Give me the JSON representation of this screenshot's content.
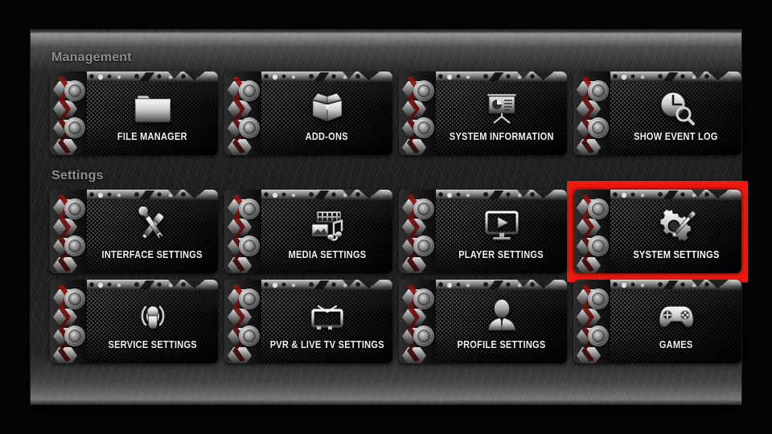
{
  "window": {
    "accent_selected": "#f01a10",
    "background": "#050505",
    "panel_background": "#222222"
  },
  "sections": [
    {
      "id": "management",
      "label": "Management",
      "rows": [
        [
          {
            "label": "FILE MANAGER",
            "icon": "folder-icon",
            "selected": false
          },
          {
            "label": "ADD-ONS",
            "icon": "open-box-icon",
            "selected": false
          },
          {
            "label": "SYSTEM INFORMATION",
            "icon": "presentation-chart-icon",
            "selected": false
          },
          {
            "label": "SHOW EVENT LOG",
            "icon": "clock-search-icon",
            "selected": false
          }
        ]
      ]
    },
    {
      "id": "settings",
      "label": "Settings",
      "rows": [
        [
          {
            "label": "INTERFACE SETTINGS",
            "icon": "screwdriver-wrench-icon",
            "selected": false
          },
          {
            "label": "MEDIA SETTINGS",
            "icon": "film-photo-music-icon",
            "selected": false
          },
          {
            "label": "PLAYER SETTINGS",
            "icon": "monitor-play-icon",
            "selected": false
          },
          {
            "label": "SYSTEM SETTINGS",
            "icon": "gear-screwdriver-icon",
            "selected": true
          }
        ],
        [
          {
            "label": "SERVICE SETTINGS",
            "icon": "broadcast-signal-icon",
            "selected": false
          },
          {
            "label": "PVR & LIVE TV SETTINGS",
            "icon": "retro-tv-icon",
            "selected": false
          },
          {
            "label": "PROFILE SETTINGS",
            "icon": "person-silhouette-icon",
            "selected": false
          },
          {
            "label": "GAMES",
            "icon": "gamepad-icon",
            "selected": false
          }
        ]
      ]
    }
  ]
}
